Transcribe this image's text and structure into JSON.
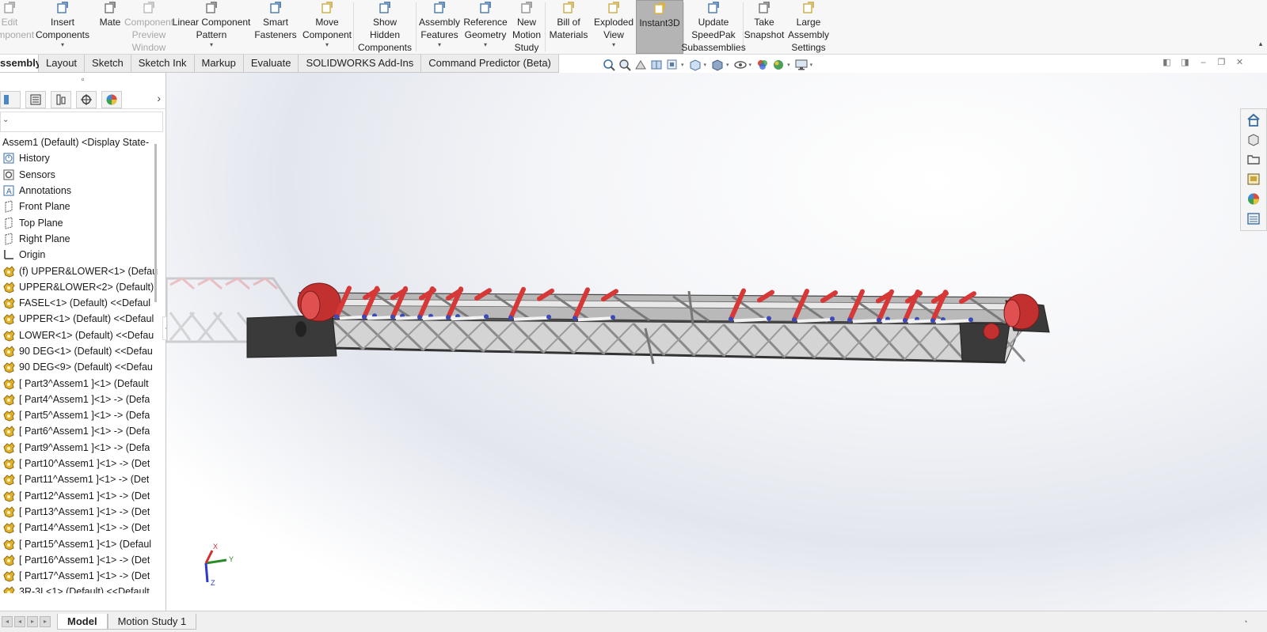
{
  "ribbon": {
    "buttons": [
      {
        "label": "Edit\nComponent",
        "icon": "edit-component-icon",
        "disabled": true
      },
      {
        "label": "Insert\nComponents",
        "icon": "insert-components-icon",
        "caret": true
      },
      {
        "label": "Mate",
        "icon": "mate-icon"
      },
      {
        "label": "Component\nPreview\nWindow",
        "icon": "preview-window-icon",
        "disabled": true
      },
      {
        "label": "Linear Component\nPattern",
        "icon": "linear-pattern-icon",
        "caret": true
      },
      {
        "label": "Smart\nFasteners",
        "icon": "smart-fasteners-icon"
      },
      {
        "label": "Move\nComponent",
        "icon": "move-component-icon",
        "caret": true
      },
      {
        "label": "Show\nHidden\nComponents",
        "icon": "show-hidden-icon"
      },
      {
        "label": "Assembly\nFeatures",
        "icon": "assembly-features-icon",
        "caret": true
      },
      {
        "label": "Reference\nGeometry",
        "icon": "reference-geometry-icon",
        "caret": true
      },
      {
        "label": "New\nMotion\nStudy",
        "icon": "motion-study-icon"
      },
      {
        "label": "Bill of\nMaterials",
        "icon": "bill-of-materials-icon"
      },
      {
        "label": "Exploded\nView",
        "icon": "exploded-view-icon",
        "caret": true
      },
      {
        "label": "Instant3D",
        "icon": "instant3d-icon",
        "active": true
      },
      {
        "label": "Update\nSpeedPak\nSubassemblies",
        "icon": "speedpak-icon"
      },
      {
        "label": "Take\nSnapshot",
        "icon": "snapshot-icon"
      },
      {
        "label": "Large\nAssembly\nSettings",
        "icon": "large-assembly-icon"
      }
    ]
  },
  "tabs": [
    {
      "label": "ssembly",
      "active": true
    },
    {
      "label": "Layout"
    },
    {
      "label": "Sketch"
    },
    {
      "label": "Sketch Ink"
    },
    {
      "label": "Markup"
    },
    {
      "label": "Evaluate"
    },
    {
      "label": "SOLIDWORKS Add-Ins"
    },
    {
      "label": "Command Predictor (Beta)"
    }
  ],
  "tree": {
    "root": "Assem1 (Default) <Display State-",
    "items": [
      {
        "label": "History",
        "icon": "history-icon"
      },
      {
        "label": "Sensors",
        "icon": "sensors-icon"
      },
      {
        "label": "Annotations",
        "icon": "annotations-icon"
      },
      {
        "label": "Front Plane",
        "icon": "plane-icon"
      },
      {
        "label": "Top Plane",
        "icon": "plane-icon"
      },
      {
        "label": "Right Plane",
        "icon": "plane-icon"
      },
      {
        "label": "Origin",
        "icon": "origin-icon"
      },
      {
        "label": "(f) UPPER&LOWER<1> (Defau",
        "icon": "assembly-icon"
      },
      {
        "label": "UPPER&LOWER<2> (Default)",
        "icon": "assembly-icon"
      },
      {
        "label": "FASEL<1> (Default) <<Defaul",
        "icon": "assembly-icon"
      },
      {
        "label": "UPPER<1> (Default) <<Defaul",
        "icon": "assembly-icon"
      },
      {
        "label": "LOWER<1> (Default) <<Defau",
        "icon": "assembly-icon"
      },
      {
        "label": "90 DEG<1> (Default) <<Defau",
        "icon": "assembly-icon"
      },
      {
        "label": "90 DEG<9> (Default) <<Defau",
        "icon": "assembly-icon"
      },
      {
        "label": "[ Part3^Assem1 ]<1> (Default",
        "icon": "assembly-icon"
      },
      {
        "label": "[ Part4^Assem1 ]<1> -> (Defa",
        "icon": "assembly-icon"
      },
      {
        "label": "[ Part5^Assem1 ]<1> -> (Defa",
        "icon": "assembly-icon"
      },
      {
        "label": "[ Part6^Assem1 ]<1> -> (Defa",
        "icon": "assembly-icon"
      },
      {
        "label": "[ Part9^Assem1 ]<1> -> (Defa",
        "icon": "assembly-icon"
      },
      {
        "label": "[ Part10^Assem1 ]<1> -> (Det",
        "icon": "assembly-icon"
      },
      {
        "label": "[ Part11^Assem1 ]<1> -> (Det",
        "icon": "assembly-icon"
      },
      {
        "label": "[ Part12^Assem1 ]<1> -> (Det",
        "icon": "assembly-icon"
      },
      {
        "label": "[ Part13^Assem1 ]<1> -> (Det",
        "icon": "assembly-icon"
      },
      {
        "label": "[ Part14^Assem1 ]<1> -> (Det",
        "icon": "assembly-icon"
      },
      {
        "label": "[ Part15^Assem1 ]<1> (Defaul",
        "icon": "assembly-icon"
      },
      {
        "label": "[ Part16^Assem1 ]<1> -> (Det",
        "icon": "assembly-icon"
      },
      {
        "label": "[ Part17^Assem1 ]<1> -> (Det",
        "icon": "assembly-icon"
      },
      {
        "label": "3R-3L<1> (Default) <<Default",
        "icon": "assembly-icon"
      }
    ]
  },
  "triad": {
    "x": "X",
    "y": "Y",
    "z": "Z"
  },
  "bottom_tabs": [
    {
      "label": "Model",
      "active": true
    },
    {
      "label": "Motion Study 1"
    }
  ],
  "colors": {
    "accent_active": "#b4b4b4",
    "roller_red": "#e03a3a",
    "frame_gray": "#8a8a8a",
    "assembly_icon": "#e2b22a"
  }
}
